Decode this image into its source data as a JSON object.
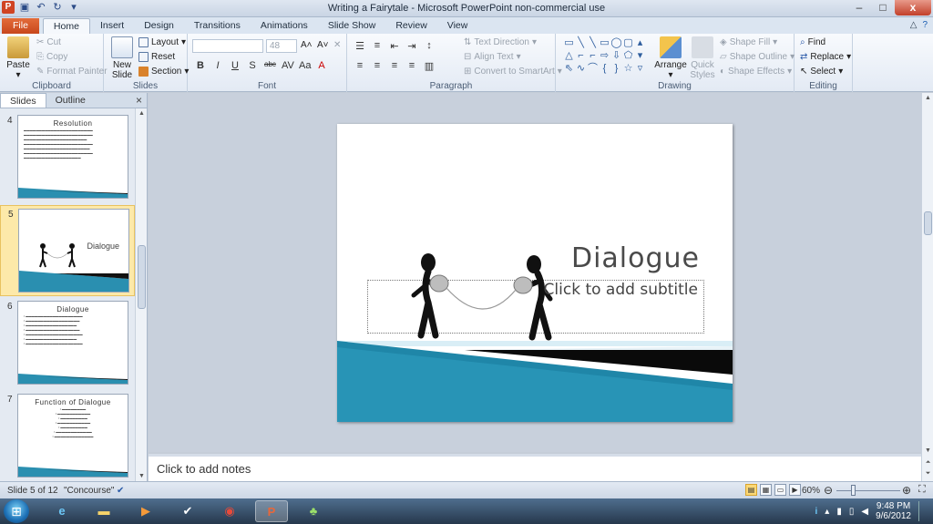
{
  "window": {
    "title": "Writing a Fairytale - Microsoft PowerPoint non-commercial use",
    "app_icon": "P",
    "minimize": "–",
    "maximize": "□",
    "close": "x"
  },
  "ribbon_tabs": [
    "File",
    "Home",
    "Insert",
    "Design",
    "Transitions",
    "Animations",
    "Slide Show",
    "Review",
    "View"
  ],
  "ribbon": {
    "clipboard": {
      "label": "Clipboard",
      "paste": "Paste",
      "cut": "Cut",
      "copy": "Copy",
      "format_painter": "Format Painter"
    },
    "slides": {
      "label": "Slides",
      "new_slide": "New Slide",
      "layout": "Layout",
      "reset": "Reset",
      "section": "Section"
    },
    "font": {
      "label": "Font",
      "font_size": "48",
      "bold": "B",
      "italic": "I",
      "underline": "U",
      "strike": "abc"
    },
    "paragraph": {
      "label": "Paragraph",
      "text_direction": "Text Direction",
      "align_text": "Align Text",
      "convert_smartart": "Convert to SmartArt"
    },
    "drawing": {
      "label": "Drawing",
      "arrange": "Arrange",
      "quick_styles": "Quick Styles",
      "shape_fill": "Shape Fill",
      "shape_outline": "Shape Outline",
      "shape_effects": "Shape Effects"
    },
    "editing": {
      "label": "Editing",
      "find": "Find",
      "replace": "Replace",
      "select": "Select"
    }
  },
  "pane": {
    "tab_slides": "Slides",
    "tab_outline": "Outline",
    "close": "×",
    "thumbnails": [
      {
        "number": "4",
        "title": "Resolution"
      },
      {
        "number": "5",
        "title": "Dialogue"
      },
      {
        "number": "6",
        "title": "Dialogue"
      },
      {
        "number": "7",
        "title": "Function of Dialogue"
      }
    ]
  },
  "slide": {
    "title": "Dialogue",
    "subtitle_placeholder": "Click to add subtitle"
  },
  "notes": {
    "placeholder": "Click to add notes"
  },
  "status": {
    "slide_info": "Slide 5 of 12",
    "theme": "\"Concourse\"",
    "zoom": "60%"
  },
  "taskbar": {
    "time": "9:48 PM",
    "date": "9/6/2012"
  }
}
